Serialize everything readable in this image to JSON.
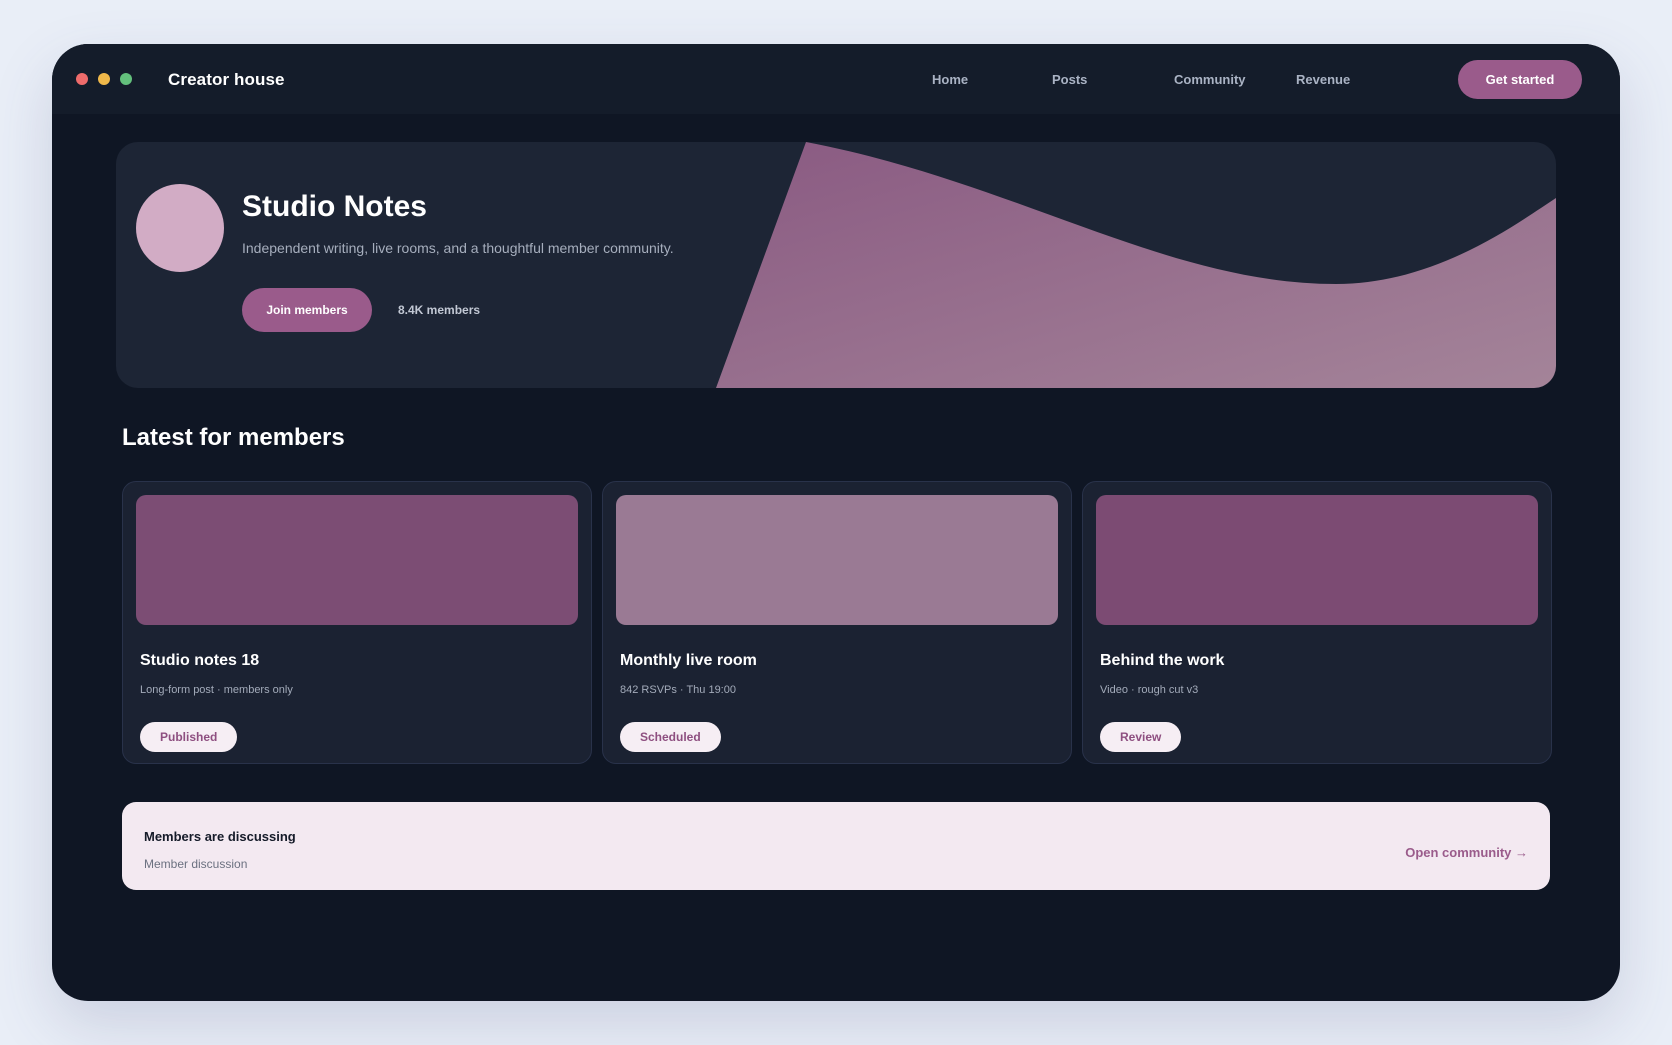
{
  "window": {
    "brand": "Creator house",
    "nav": [
      {
        "label": "Home"
      },
      {
        "label": "Posts"
      },
      {
        "label": "Community"
      },
      {
        "label": "Revenue"
      }
    ],
    "cta_label": "Get started"
  },
  "hero": {
    "title": "Studio Notes",
    "subtitle": "Independent writing, live rooms, and a thoughtful member community.",
    "join_label": "Join members",
    "member_count": "8.4K members"
  },
  "latest": {
    "title": "Latest for members",
    "cards": [
      {
        "title": "Studio notes 18",
        "meta": "Long-form post · members only",
        "status": "Published",
        "thumb_color": "#7c4d74"
      },
      {
        "title": "Monthly live room",
        "meta": "842 RSVPs · Thu 19:00",
        "status": "Scheduled",
        "thumb_color": "#9a7a94"
      },
      {
        "title": "Behind the work",
        "meta": "Video · rough cut v3",
        "status": "Review",
        "thumb_color": "#7c4b73"
      }
    ]
  },
  "discussion": {
    "title": "Members are discussing",
    "subtitle": "Member discussion",
    "link_label": "Open community →"
  },
  "colors": {
    "accent": "#9a5b8b",
    "background": "#0f1624",
    "surface": "#1d2535",
    "badge_bg": "#f6eef4",
    "panel_light": "#f3e9f1"
  }
}
